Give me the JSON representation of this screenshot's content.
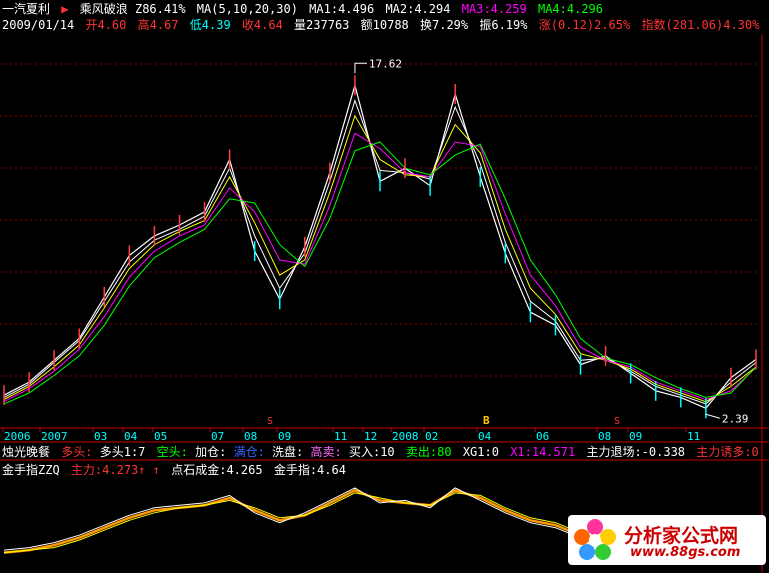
{
  "header": {
    "stock_name": "一汽夏利",
    "indicator_name": "乘风破浪",
    "indicator_value": "Z86.41%",
    "ma_def": "MA(5,10,20,30)",
    "ma1": "MA1:4.496",
    "ma2": "MA2:4.294",
    "ma3": "MA3:4.259",
    "ma4": "MA4:4.296"
  },
  "quote": {
    "date": "2009/01/14",
    "open": "开4.60",
    "high": "高4.67",
    "low": "低4.39",
    "close": "收4.64",
    "volume": "量237763",
    "amount": "额10788",
    "turnover": "换7.29%",
    "amplitude": "振6.19%",
    "change": "涨(0.12)2.65%",
    "index": "指数(281.06)4.30%"
  },
  "annotations": {
    "high_label": "17.62",
    "low_label": "2.39",
    "sell_marker": "S",
    "buy_marker": "B"
  },
  "indicator_row": {
    "name": "烛光晚餐",
    "duotou": "多头:",
    "duotou_val": "多头1:7",
    "kongtou": "空头:",
    "jiacang": "加仓:",
    "jiacang_blue": "满仓:",
    "xipan": "洗盘:",
    "gaomai": "高卖:",
    "mairu": "买入:10",
    "maichu": "卖出:80",
    "xg": "XG1:0",
    "x1": "X1:14.571",
    "zhuli_tuichang": "主力退场:-0.338",
    "zhuli_youduo": "主力诱多:0"
  },
  "bottom_indicator": {
    "name": "金手指ZZQ",
    "zhuli": "主力:4.273",
    "dianshi": "点石成金:4.265",
    "jinshouzhi": "金手指:4.64"
  },
  "watermark": {
    "text": "分析家公式网",
    "url": "www.88gs.com"
  },
  "chart_data": {
    "type": "line",
    "title": "一汽夏利",
    "x_tick_labels": [
      "2006",
      "2007",
      "03",
      "04",
      "05",
      "07",
      "08",
      "09",
      "11",
      "12",
      "2008",
      "02",
      "04",
      "06",
      "08",
      "09",
      "11"
    ],
    "ylim": [
      2.0,
      19.0
    ],
    "x": [
      "2006-01",
      "2006-03",
      "2006-05",
      "2006-07",
      "2006-09",
      "2006-11",
      "2007-01",
      "2007-02",
      "2007-03",
      "2007-04",
      "2007-05",
      "2007-06",
      "2007-07",
      "2007-08",
      "2007-09",
      "2007-10",
      "2007-11",
      "2007-12",
      "2008-01",
      "2008-02",
      "2008-03",
      "2008-04",
      "2008-05",
      "2008-06",
      "2008-07",
      "2008-08",
      "2008-09",
      "2008-10",
      "2008-11",
      "2008-12",
      "2009-01"
    ],
    "series": [
      {
        "name": "收",
        "values": [
          3.0,
          3.6,
          4.6,
          5.6,
          7.5,
          9.4,
          10.3,
          10.8,
          11.4,
          13.8,
          9.6,
          7.4,
          9.8,
          13.2,
          17.2,
          12.8,
          13.4,
          12.6,
          16.8,
          13.0,
          9.5,
          6.8,
          6.2,
          4.4,
          4.8,
          4.0,
          3.2,
          2.9,
          2.4,
          3.8,
          4.64
        ]
      },
      {
        "name": "MA1",
        "values": [
          2.9,
          3.5,
          4.5,
          5.5,
          7.3,
          9.1,
          10.1,
          10.6,
          11.2,
          13.4,
          10.3,
          7.9,
          9.5,
          12.8,
          16.5,
          13.3,
          13.2,
          12.9,
          16.2,
          13.6,
          10.0,
          7.3,
          6.4,
          4.6,
          4.7,
          4.1,
          3.4,
          3.0,
          2.6,
          3.6,
          4.496
        ]
      },
      {
        "name": "MA2",
        "values": [
          2.8,
          3.4,
          4.3,
          5.3,
          7.0,
          8.8,
          9.9,
          10.5,
          11.0,
          13.0,
          10.9,
          8.5,
          9.2,
          12.3,
          15.8,
          13.8,
          13.1,
          13.0,
          15.4,
          14.1,
          10.6,
          7.9,
          6.7,
          4.9,
          4.6,
          4.2,
          3.5,
          3.1,
          2.7,
          3.4,
          4.294
        ]
      },
      {
        "name": "MA3",
        "values": [
          2.7,
          3.3,
          4.1,
          5.1,
          6.6,
          8.4,
          9.6,
          10.3,
          10.8,
          12.5,
          11.4,
          9.2,
          9.0,
          11.7,
          15.0,
          14.3,
          13.2,
          13.0,
          14.6,
          14.4,
          11.3,
          8.5,
          7.1,
          5.2,
          4.6,
          4.3,
          3.6,
          3.2,
          2.8,
          3.2,
          4.259
        ]
      },
      {
        "name": "MA4",
        "values": [
          2.6,
          3.1,
          3.9,
          4.8,
          6.2,
          8.0,
          9.3,
          10.0,
          10.6,
          12.0,
          11.8,
          9.9,
          8.9,
          11.1,
          14.2,
          14.6,
          13.4,
          13.1,
          14.0,
          14.5,
          12.0,
          9.2,
          7.6,
          5.6,
          4.7,
          4.4,
          3.8,
          3.3,
          2.9,
          3.1,
          4.296
        ]
      }
    ],
    "bottom_series": [
      {
        "name": "主力",
        "values": [
          30,
          31,
          33,
          36,
          40,
          44,
          47,
          48,
          49,
          52,
          47,
          43,
          45,
          50,
          55,
          51,
          50,
          49,
          55,
          52,
          47,
          43,
          41,
          37,
          36,
          34,
          32,
          30,
          29,
          31,
          33
        ]
      },
      {
        "name": "点石成金",
        "values": [
          30,
          31,
          32,
          35,
          39,
          43,
          46,
          48,
          49,
          51,
          48,
          44,
          45,
          49,
          54,
          52,
          50,
          49,
          54,
          53,
          48,
          44,
          42,
          38,
          36,
          35,
          33,
          31,
          30,
          30,
          32
        ]
      },
      {
        "name": "金手指",
        "values": [
          31,
          32,
          34,
          37,
          41,
          45,
          48,
          49,
          50,
          53,
          46,
          42,
          46,
          51,
          56,
          50,
          51,
          48,
          56,
          51,
          46,
          42,
          40,
          36,
          37,
          34,
          31,
          29,
          28,
          32,
          34
        ]
      }
    ],
    "colors": {
      "close": "#ffffff",
      "ma1": "#ffffff",
      "ma2": "#ffff00",
      "ma3": "#ff00ff",
      "ma4": "#00ff00",
      "grid": "#8b0000",
      "axis": "#c00000",
      "zhuli": "#ff9900",
      "dianshi": "#ffff00",
      "jinshouzhi": "#ffffff"
    }
  }
}
